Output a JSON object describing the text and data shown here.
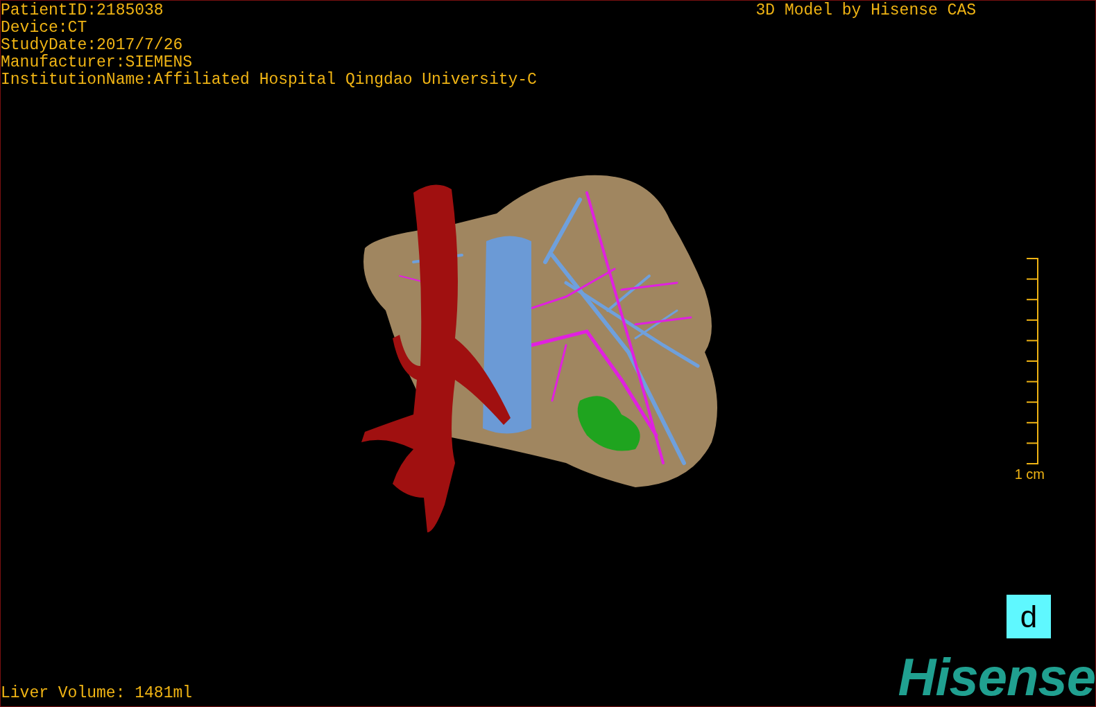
{
  "info_lines": [
    "PatientID:2185038",
    "Device:CT",
    "StudyDate:2017/7/26",
    "Manufacturer:SIEMENS",
    "InstitutionName:Affiliated Hospital Qingdao University-C"
  ],
  "credit": "3D Model by Hisense CAS",
  "scale": {
    "label": "1 cm"
  },
  "orientation_marker": "d",
  "logo": "Hisense",
  "liver_volume": "Liver Volume: 1481ml"
}
